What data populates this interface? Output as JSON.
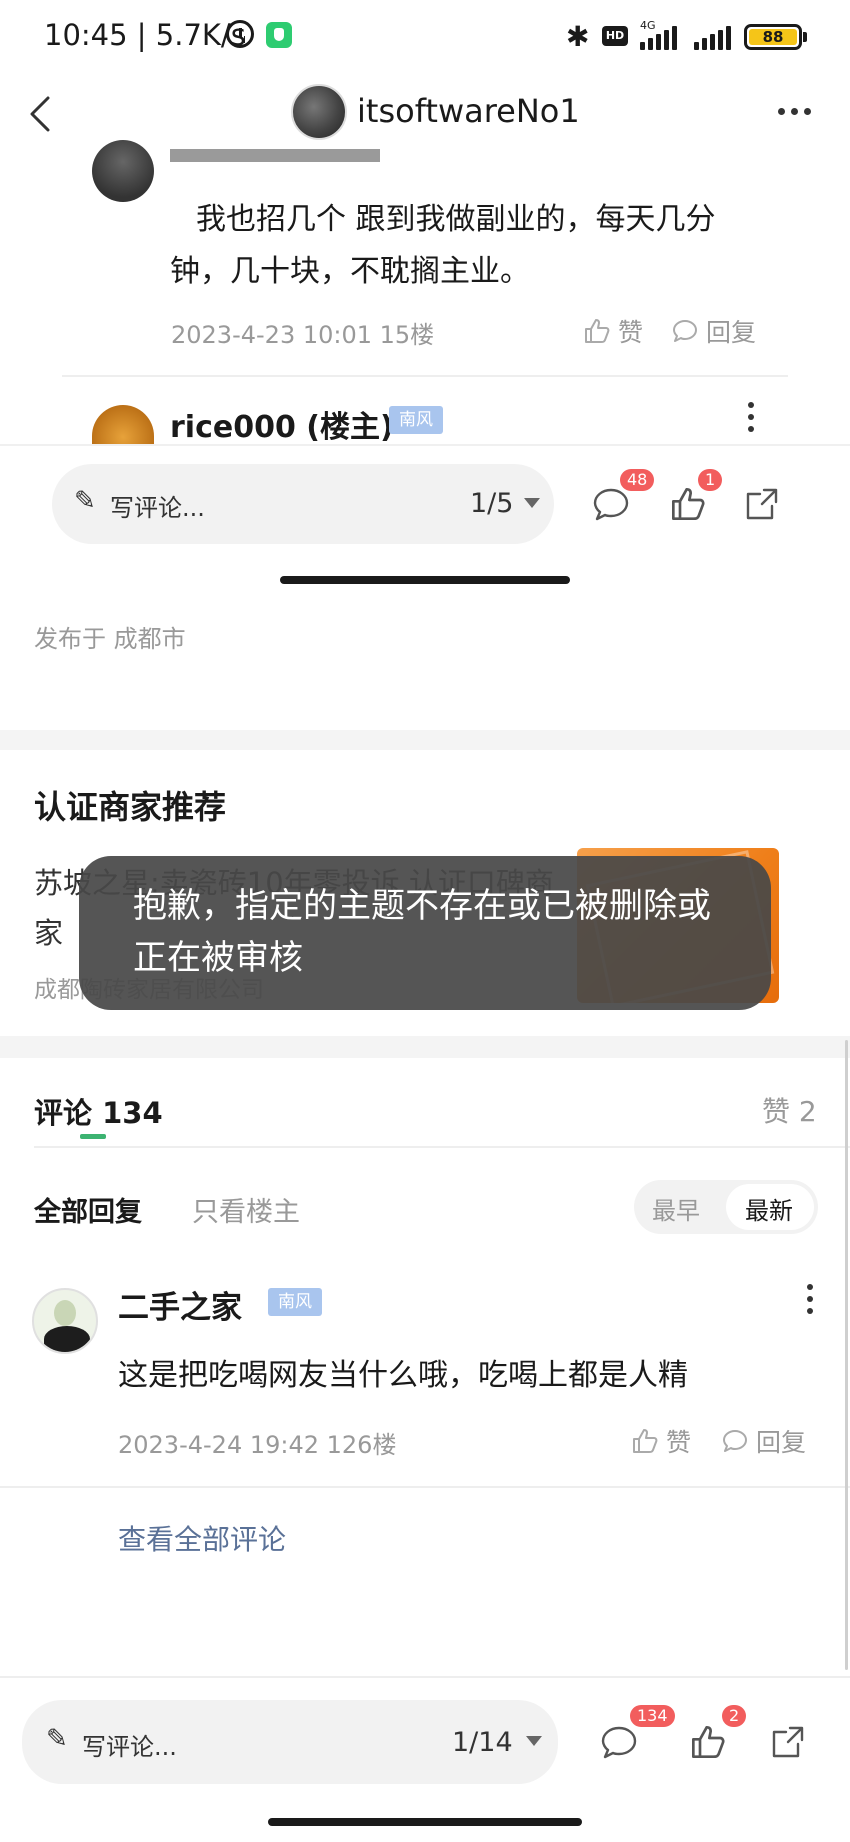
{
  "status_bar": {
    "time_speed": "10:45 | 5.7K/s",
    "hd": "HD",
    "network": "4G",
    "battery": "88",
    "alarm_icon": "alarm-icon",
    "bluetooth_icon": "bluetooth-icon"
  },
  "header": {
    "title": "itsoftwareNo1",
    "back_icon": "back-arrow-icon",
    "more_icon": "more-dots-icon"
  },
  "floating_preview": {
    "comment_body": "我也招几个 跟到我做副业的，每天几分钟，几十块，不耽搁主业。",
    "comment_meta": "2023-4-23 10:01  15楼",
    "like_label": "赞",
    "reply_label": "回复",
    "next_author": "rice000 (楼主)",
    "next_badge": "南风"
  },
  "comment_bar_top": {
    "placeholder": "写评论...",
    "page": "1/5",
    "comment_count": "48",
    "like_count": "1"
  },
  "published": "发布于 成都市",
  "merchant": {
    "heading": "认证商家推荐",
    "title": "苏坡之星:卖瓷砖10年零投诉 认证口碑商家",
    "company": "成都陶砖家居有限公司"
  },
  "toast": {
    "message": "抱歉，指定的主题不存在或已被删除或正在被审核"
  },
  "comments": {
    "title": "评论 134",
    "likes": "赞 2",
    "filter_all": "全部回复",
    "filter_op": "只看楼主",
    "sort_earliest": "最早",
    "sort_latest": "最新",
    "items": [
      {
        "author": "二手之家",
        "badge": "南风",
        "body": "这是把吃喝网友当什么哦，吃喝上都是人精",
        "meta": "2023-4-24 19:42  126楼",
        "like_label": "赞",
        "reply_label": "回复"
      }
    ],
    "view_all": "查看全部评论"
  },
  "comment_bar_bottom": {
    "placeholder": "写评论...",
    "page": "1/14",
    "comment_count": "134",
    "like_count": "2"
  },
  "colors": {
    "accent_green": "#3cb371",
    "badge_blue": "#a9c5ee",
    "count_red": "#f25d5d",
    "link_blue": "#5a7197"
  }
}
